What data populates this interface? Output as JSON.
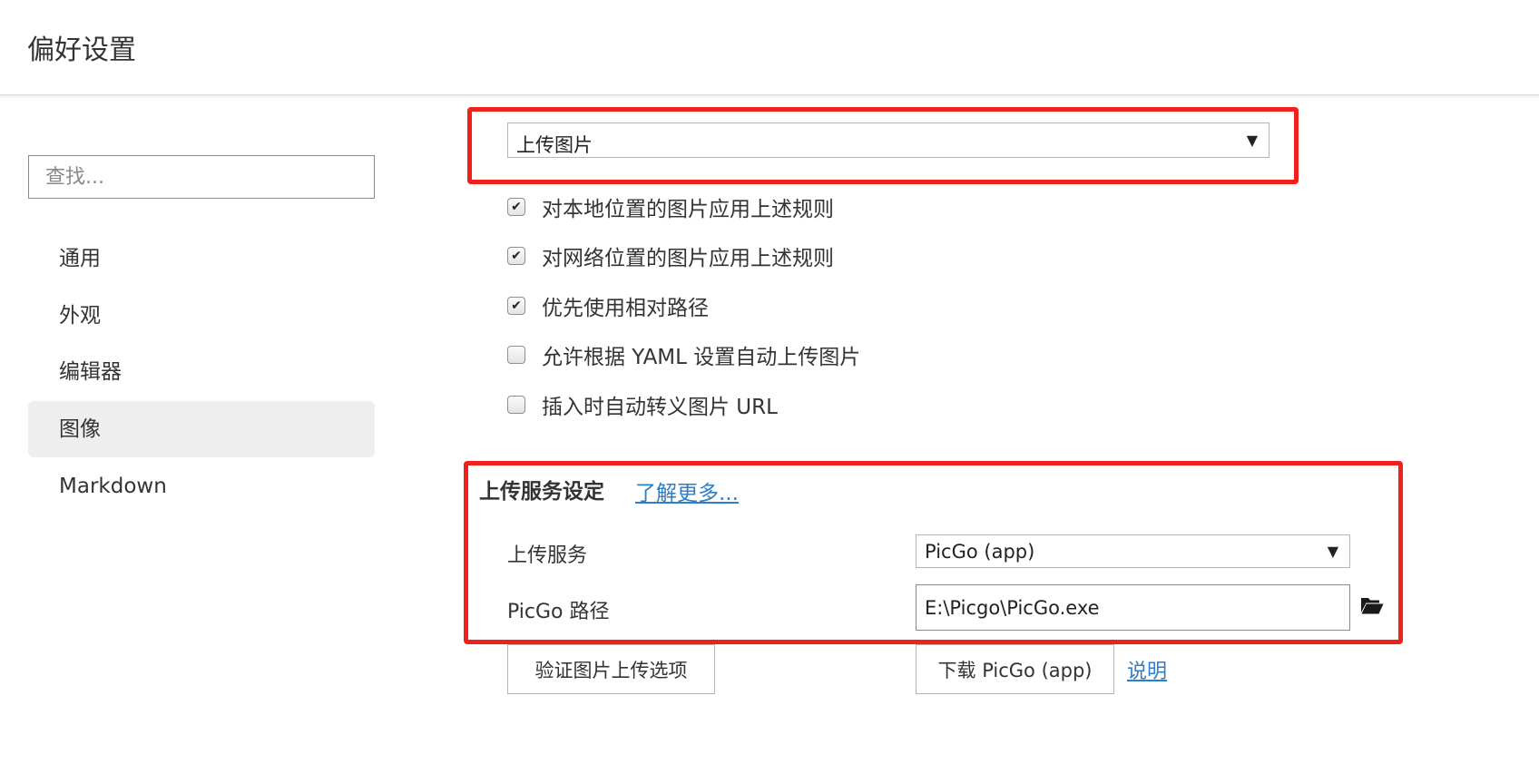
{
  "header": {
    "title": "偏好设置"
  },
  "sidebar": {
    "search_placeholder": "查找...",
    "items": [
      {
        "label": "通用"
      },
      {
        "label": "外观"
      },
      {
        "label": "编辑器"
      },
      {
        "label": "图像",
        "active": true
      },
      {
        "label": "Markdown"
      }
    ]
  },
  "image_settings": {
    "insert_action_select": {
      "value": "上传图片"
    },
    "options": [
      {
        "label": "对本地位置的图片应用上述规则",
        "checked": true
      },
      {
        "label": "对网络位置的图片应用上述规则",
        "checked": true
      },
      {
        "label": "优先使用相对路径",
        "checked": true
      },
      {
        "label": "允许根据 YAML 设置自动上传图片",
        "checked": false
      },
      {
        "label": "插入时自动转义图片 URL",
        "checked": false
      }
    ]
  },
  "upload_service": {
    "title": "上传服务设定",
    "learn_more": "了解更多...",
    "service_label": "上传服务",
    "service_value": "PicGo (app)",
    "path_label": "PicGo 路径",
    "path_value": "E:\\Picgo\\PicGo.exe",
    "verify_button": "验证图片上传选项",
    "download_button": "下载 PicGo (app)",
    "help_link": "说明"
  },
  "icons": {
    "dropdown_arrow": "▼",
    "checkmark": "✔",
    "folder": "folder-open-icon"
  },
  "colors": {
    "highlight_frame": "#f0211b",
    "link": "#2d7dc7",
    "active_nav_bg": "#eeeeee"
  }
}
